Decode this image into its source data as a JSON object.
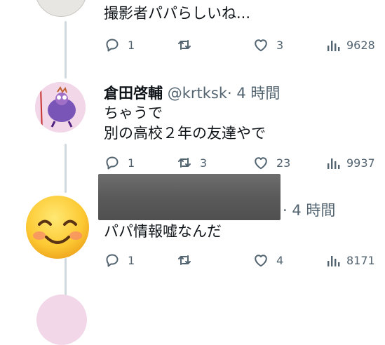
{
  "tweets": [
    {
      "text_lines": [
        "撮影者パパらしいね..."
      ],
      "actions": {
        "replies": "1",
        "retweets": "",
        "likes": "3",
        "views": "9628"
      }
    },
    {
      "display_name": "倉田啓輔",
      "handle": "@krtksk",
      "time": "· 4 時間",
      "text_lines": [
        "ちゃうで",
        "別の高校２年の友達やで"
      ],
      "actions": {
        "replies": "1",
        "retweets": "3",
        "likes": "23",
        "views": "9937"
      }
    },
    {
      "time": "· 4 時間",
      "text_lines": [
        "パパ情報嘘なんだ"
      ],
      "actions": {
        "replies": "1",
        "retweets": "",
        "likes": "4",
        "views": "8171"
      }
    }
  ],
  "icons": [
    "reply-icon",
    "retweet-icon",
    "like-icon",
    "views-icon",
    "smiling-face-emoji-icon"
  ],
  "colors": {
    "icon_gray": "#536471",
    "thread_line": "#cfd9de",
    "avatar_bg": "#f2d7e8"
  }
}
